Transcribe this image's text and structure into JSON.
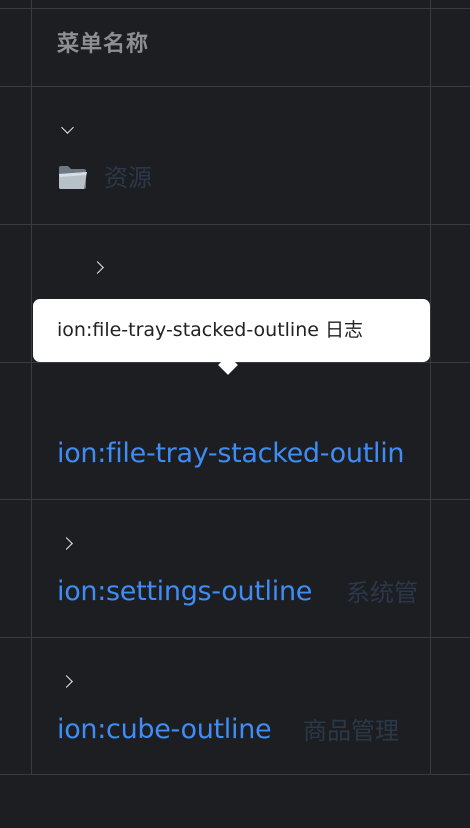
{
  "table": {
    "header": {
      "menu_name": "菜单名称"
    },
    "rows": [
      {
        "icon": "folder-icon",
        "name": "资源",
        "expanded": true
      },
      {
        "icon": "ion:file-tray-stacked-outline",
        "name": "日志",
        "expanded": false,
        "truncated_icon_text": "ion:file-tray-stacked-outlin"
      },
      {
        "icon": "ion:settings-outline",
        "name": "系统管",
        "expanded": false
      },
      {
        "icon": "ion:cube-outline",
        "name": "商品管理",
        "expanded": false
      }
    ]
  },
  "tooltip": {
    "text": "ion:file-tray-stacked-outline 日志"
  },
  "colors": {
    "background": "#1d1e21",
    "grid_line": "#3a3b3e",
    "link_blue": "#3f8cf5",
    "header_text": "#8e8f93",
    "tooltip_bg": "#ffffff"
  }
}
